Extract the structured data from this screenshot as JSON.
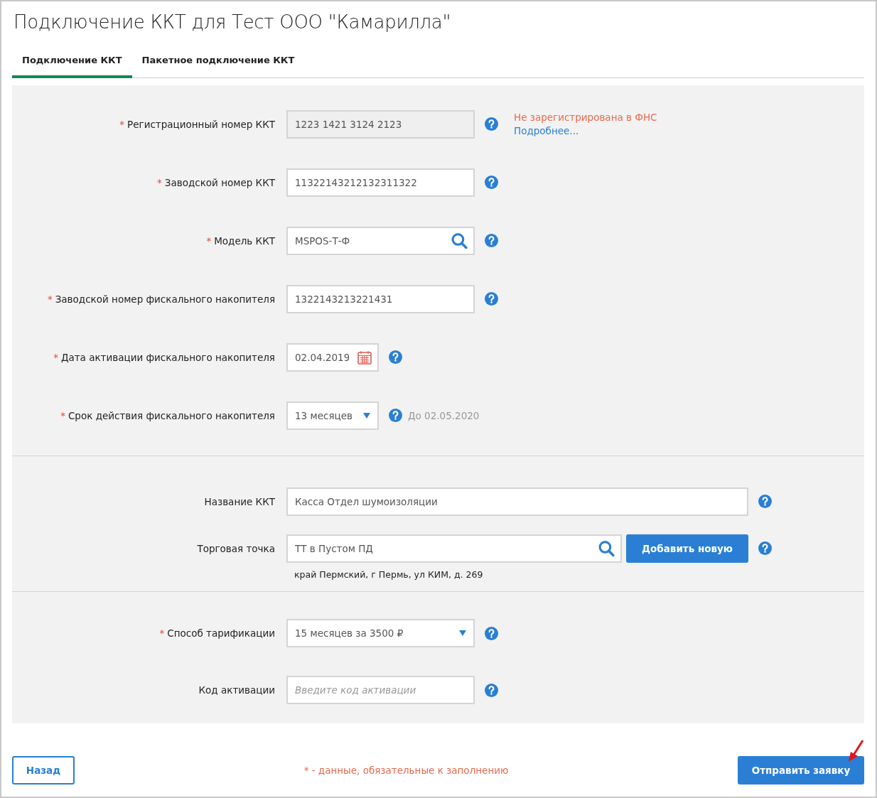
{
  "title": "Подключение ККТ для Тест ООО \"Камарилла\"",
  "tabs": [
    {
      "label": "Подключение ККТ",
      "selected": true
    },
    {
      "label": "Пакетное подключение ККТ",
      "selected": false
    }
  ],
  "sections": [
    {
      "fields": [
        {
          "label": "Регистрационный номер ККТ",
          "required_mark": "*",
          "kind": "text",
          "value": "1223 1421 3124 2123",
          "disabled": true,
          "status": "Не зарегистрирована в ФНС",
          "link": "Подробнее..."
        },
        {
          "label": "Заводской номер ККТ",
          "required_mark": "*",
          "kind": "text",
          "value": "11322143212132311322",
          "disabled": false
        },
        {
          "label": "Модель ККТ",
          "required_mark": "*",
          "kind": "search",
          "value": "MSPOS-Т-Ф",
          "disabled": false
        },
        {
          "label": "Заводской номер фискального накопителя",
          "required_mark": "*",
          "kind": "text",
          "value": "1322143213221431",
          "disabled": false
        },
        {
          "label": "Дата активации фискального накопителя",
          "required_mark": "*",
          "kind": "date",
          "value": "02.04.2019",
          "disabled": false
        },
        {
          "label": "Срок действия фискального накопителя",
          "required_mark": "*",
          "kind": "short-select",
          "value": "13 месяцев",
          "disabled": false,
          "hint": "До 02.05.2020"
        }
      ]
    },
    {
      "fields": [
        {
          "label": "Название ККТ",
          "kind": "wide-text",
          "value": "Касса Отдел шумоизоляции",
          "disabled": false
        },
        {
          "label": "Торговая точка",
          "kind": "wide-search",
          "value": "ТТ в Пустом ПД",
          "disabled": false,
          "button": "Добавить новую",
          "address": "край Пермский, г Пермь, ул КИМ, д. 269"
        }
      ]
    },
    {
      "fields": [
        {
          "label": "Способ тарификации",
          "required_mark": "*",
          "kind": "select",
          "value": "15 месяцев за 3500 ₽",
          "disabled": false
        },
        {
          "label": "Код активации",
          "kind": "text",
          "placeholder": "Введите код активации",
          "disabled": false
        }
      ]
    }
  ],
  "footer": {
    "back_button": "Назад",
    "required_note": "* - данные, обязательные к заполнению",
    "submit_button": "Отправить заявку"
  }
}
